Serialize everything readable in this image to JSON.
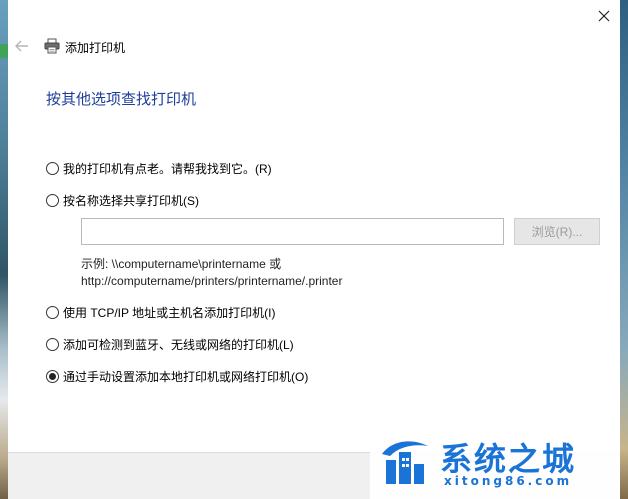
{
  "window": {
    "title": "添加打印机"
  },
  "heading": "按其他选项查找打印机",
  "options": [
    {
      "label": "我的打印机有点老。请帮我找到它。(R)",
      "checked": false
    },
    {
      "label": "按名称选择共享打印机(S)",
      "checked": false
    },
    {
      "label": "使用 TCP/IP 地址或主机名添加打印机(I)",
      "checked": false
    },
    {
      "label": "添加可检测到蓝牙、无线或网络的打印机(L)",
      "checked": false
    },
    {
      "label": "通过手动设置添加本地打印机或网络打印机(O)",
      "checked": true
    }
  ],
  "shared_printer": {
    "input_value": "",
    "browse_label": "浏览(R)...",
    "example_line1": "示例: \\\\computername\\printername 或",
    "example_line2": "http://computername/printers/printername/.printer"
  },
  "watermark": {
    "text": "系统之城",
    "sub": "xitong86.com"
  },
  "icons": {
    "back": "back-arrow-icon",
    "printer": "printer-icon",
    "close": "close-icon"
  }
}
